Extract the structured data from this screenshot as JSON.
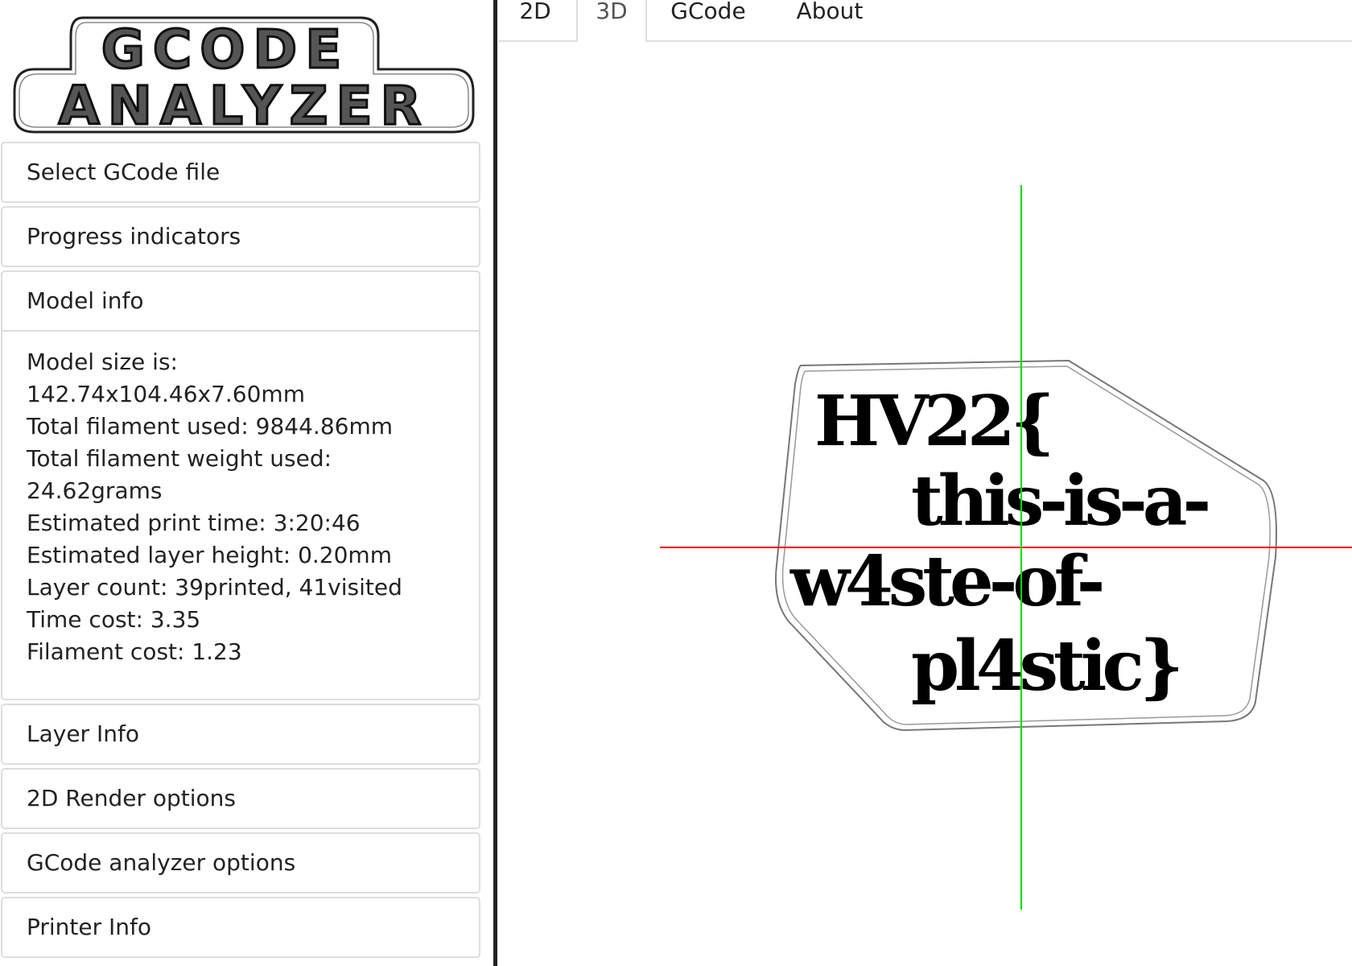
{
  "logo": {
    "line1": "GCODE",
    "line2": "ANALYZER"
  },
  "sidebar": {
    "panels": [
      {
        "label": "Select GCode file"
      },
      {
        "label": "Progress indicators"
      },
      {
        "label": "Model info"
      },
      {
        "label": "Layer Info"
      },
      {
        "label": "2D Render options"
      },
      {
        "label": "GCode analyzer options"
      },
      {
        "label": "Printer Info"
      }
    ],
    "model_info": {
      "lines": [
        "Model size is:",
        "142.74x104.46x7.60mm",
        "Total filament used: 9844.86mm",
        "Total filament weight used:",
        "24.62grams",
        "Estimated print time: 3:20:46",
        "Estimated layer height: 0.20mm",
        "Layer count: 39printed, 41visited",
        "Time cost: 3.35",
        "Filament cost: 1.23"
      ]
    }
  },
  "tabs": [
    {
      "label": "2D",
      "active": false
    },
    {
      "label": "3D",
      "active": true
    },
    {
      "label": "GCode",
      "active": false
    },
    {
      "label": "About",
      "active": false
    }
  ],
  "viewport": {
    "model_text": {
      "line1": "HV22{",
      "line2": "this-is-a-",
      "line3": "w4ste-of-",
      "line4": "pl4stic}"
    },
    "axis_colors": {
      "x": "#ff0000",
      "y": "#00dd00"
    }
  },
  "colors": {
    "panel_border": "#dddddd",
    "divider": "#222222",
    "text": "#222222"
  }
}
